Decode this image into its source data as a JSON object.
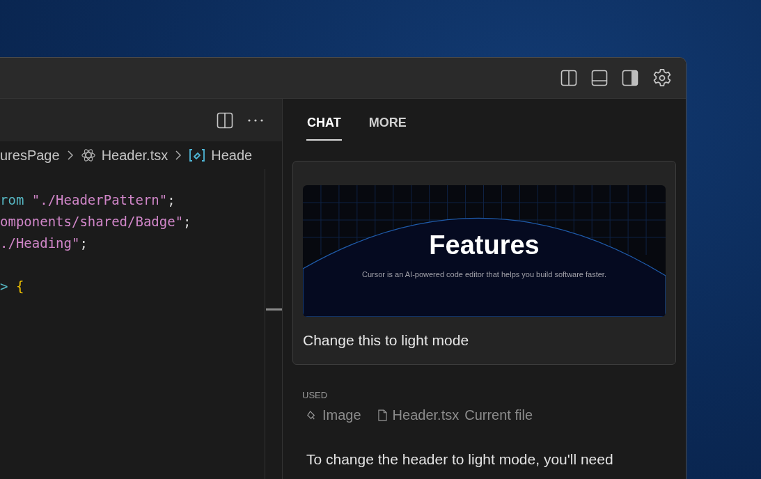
{
  "title_bar": {
    "icons": [
      {
        "kind": "left-panel"
      },
      {
        "kind": "bottom-panel"
      },
      {
        "kind": "right-panel"
      },
      {
        "kind": "settings"
      }
    ]
  },
  "editor": {
    "breadcrumbs": [
      {
        "kind": "folder",
        "label": "uresPage"
      },
      {
        "kind": "react",
        "label": "Header.tsx"
      },
      {
        "kind": "symbol",
        "label": "Heade"
      }
    ],
    "code_lines": [
      {
        "kind": "code",
        "tokens": [
          {
            "kind": "keyword",
            "text": "rom"
          },
          {
            "kind": "string",
            "text": " \"./HeaderPattern\""
          },
          {
            "kind": "punct",
            "text": ";"
          }
        ]
      },
      {
        "kind": "code",
        "tokens": [
          {
            "kind": "string",
            "text": "omponents/shared/Badge\""
          },
          {
            "kind": "punct",
            "text": ";"
          }
        ]
      },
      {
        "kind": "code",
        "tokens": [
          {
            "kind": "string",
            "text": "./Heading\""
          },
          {
            "kind": "punct",
            "text": ";"
          }
        ]
      },
      {
        "kind": "blank"
      },
      {
        "kind": "code",
        "tokens": [
          {
            "kind": "keyword",
            "text": ">"
          },
          {
            "kind": "brace",
            "text": " {"
          }
        ]
      }
    ]
  },
  "chat": {
    "tabs": [
      {
        "label": "CHAT",
        "selected": true
      },
      {
        "label": "MORE",
        "selected": false
      }
    ],
    "message": {
      "image": {
        "heading": "Features",
        "subtitle": "Cursor is an AI-powered code editor that helps you build software faster."
      },
      "text": "Change this to light mode"
    },
    "used": {
      "label": "USED",
      "items": [
        {
          "kind": "image",
          "label": "Image"
        },
        {
          "kind": "file",
          "label": "Header.tsx",
          "note": "Current file"
        }
      ]
    },
    "response": "To change the header to light mode, you'll need"
  }
}
